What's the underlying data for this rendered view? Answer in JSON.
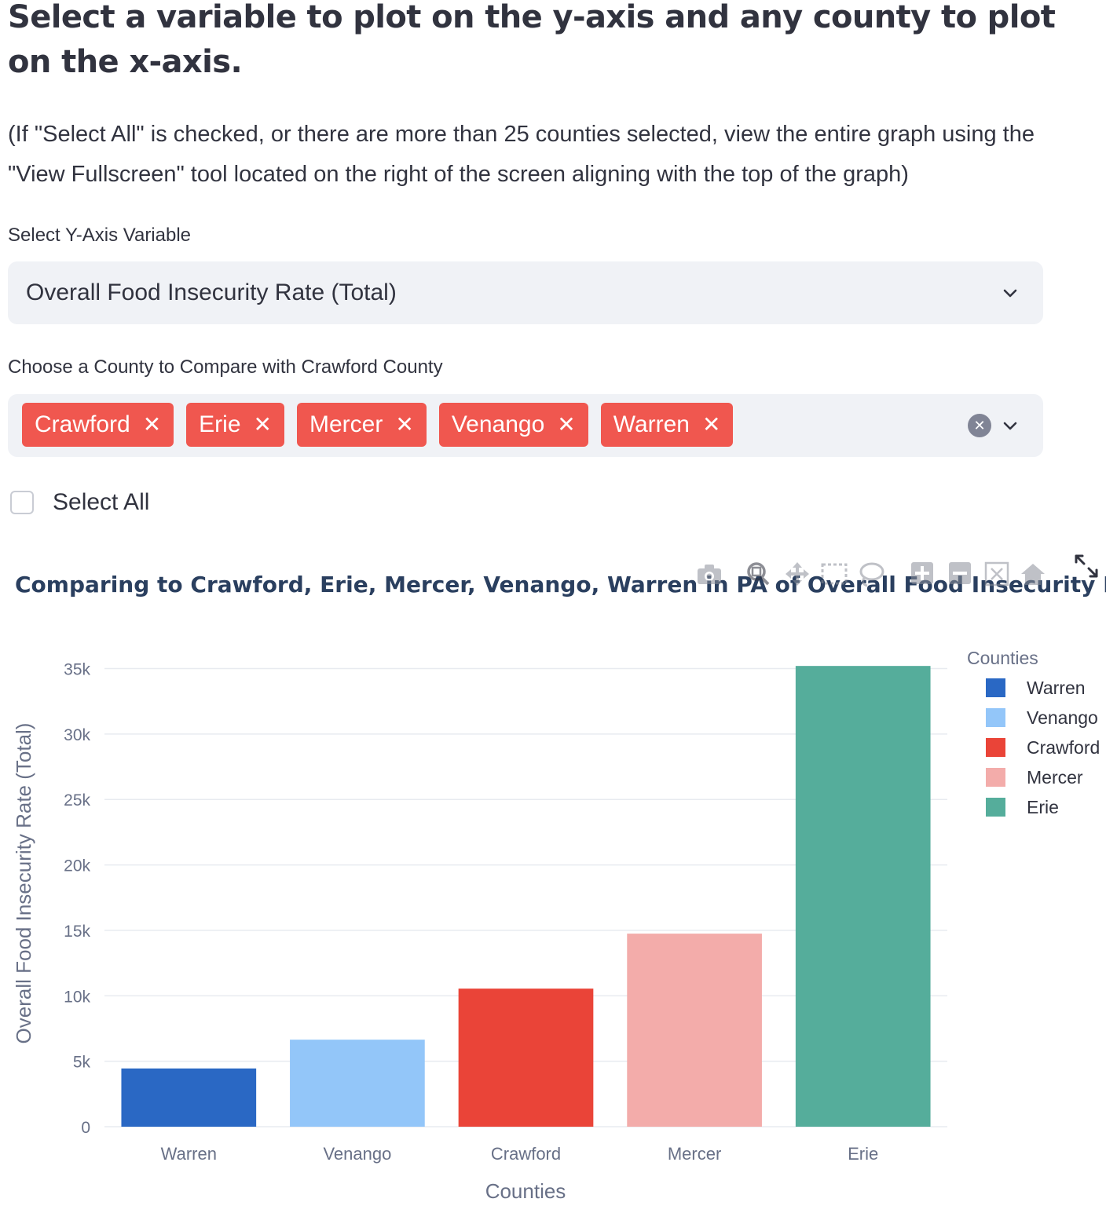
{
  "heading": "Select a variable to plot on the y-axis and any county to plot on the x-axis.",
  "note": "(If \"Select All\" is checked, or there are more than 25 counties selected, view the entire graph using the \"View Fullscreen\" tool located on the right of the screen aligning with the top of the graph)",
  "y_select": {
    "label": "Select Y-Axis Variable",
    "value": "Overall Food Insecurity Rate (Total)"
  },
  "county_select": {
    "label": "Choose a County to Compare with Crawford County",
    "tags": [
      "Crawford",
      "Erie",
      "Mercer",
      "Venango",
      "Warren"
    ],
    "tag_color": "#f0574f"
  },
  "select_all": {
    "label": "Select All",
    "checked": false
  },
  "modebar_icons": [
    "camera-icon",
    "zoom-icon",
    "pan-icon",
    "box-select-icon",
    "lasso-icon",
    "zoom-in-icon",
    "zoom-out-icon",
    "autoscale-icon",
    "reset-axes-icon"
  ],
  "chart_data": {
    "type": "bar",
    "title": "Comparing to Crawford,  Erie,  Mercer,  Venango,  Warren in PA of Overall Food Insecurity Rate (Total)",
    "title_visible": "Comparing to Crawford,  Erie,  Mercer,  Venango,  Warren in PA of Overall Food Insecurity Rate (…",
    "xlabel": "Counties",
    "ylabel": "Overall Food Insecurity Rate (Total)",
    "categories": [
      "Warren",
      "Venango",
      "Crawford",
      "Mercer",
      "Erie"
    ],
    "values": [
      4450,
      6650,
      10550,
      14750,
      35200
    ],
    "colors": [
      "#2a68c4",
      "#93c6f9",
      "#ea4438",
      "#f3acaa",
      "#55ad9b"
    ],
    "ylim": [
      0,
      35000
    ],
    "yticks": [
      0,
      5000,
      10000,
      15000,
      20000,
      25000,
      30000,
      35000
    ],
    "ytick_labels": [
      "0",
      "5k",
      "10k",
      "15k",
      "20k",
      "25k",
      "30k",
      "35k"
    ],
    "grid": true,
    "legend": {
      "title": "Counties",
      "placement": "top-right",
      "entries": [
        "Warren",
        "Venango",
        "Crawford",
        "Mercer",
        "Erie"
      ]
    }
  }
}
